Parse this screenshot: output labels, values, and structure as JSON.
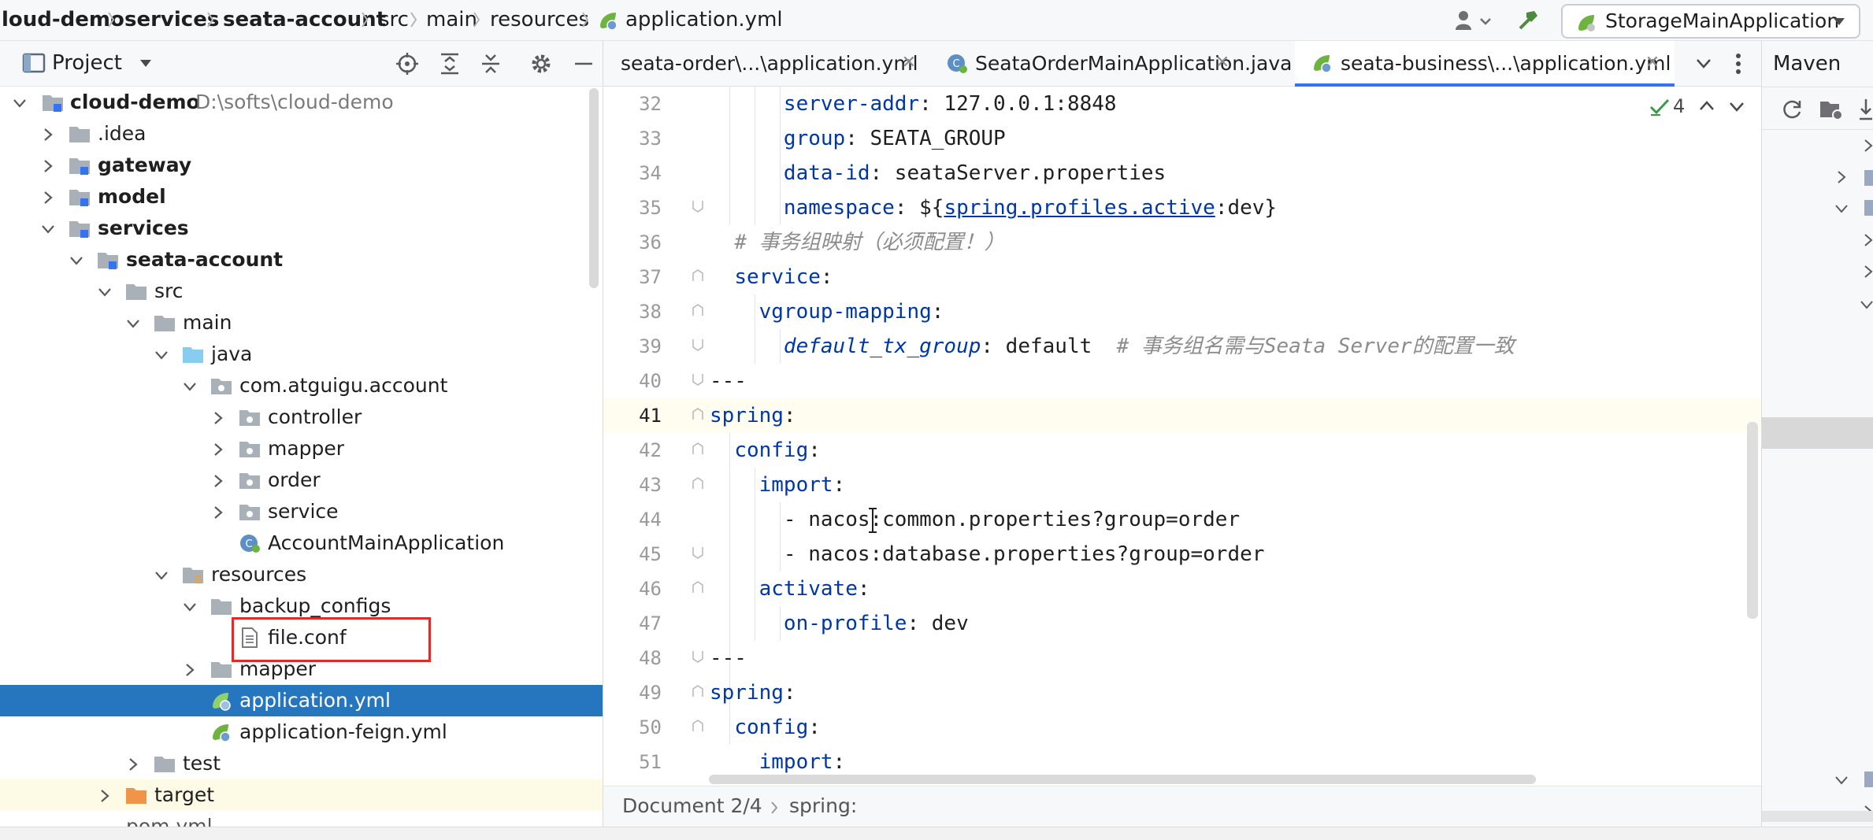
{
  "breadcrumb": {
    "items": [
      "loud-demo",
      "services",
      "seata-account",
      "src",
      "main",
      "resources",
      "application.yml"
    ]
  },
  "toolbar": {
    "run_config": "StorageMainApplication"
  },
  "project_panel": {
    "title": "Project",
    "tree": [
      {
        "label": "cloud-demo",
        "path": "D:\\softs\\cloud-demo"
      },
      {
        "label": ".idea"
      },
      {
        "label": "gateway"
      },
      {
        "label": "model"
      },
      {
        "label": "services"
      },
      {
        "label": "seata-account"
      },
      {
        "label": "src"
      },
      {
        "label": "main"
      },
      {
        "label": "java"
      },
      {
        "label": "com.atguigu.account"
      },
      {
        "label": "controller"
      },
      {
        "label": "mapper"
      },
      {
        "label": "order"
      },
      {
        "label": "service"
      },
      {
        "label": "AccountMainApplication"
      },
      {
        "label": "resources"
      },
      {
        "label": "backup_configs"
      },
      {
        "label": "file.conf"
      },
      {
        "label": "mapper"
      },
      {
        "label": "application.yml"
      },
      {
        "label": "application-feign.yml"
      },
      {
        "label": "test"
      },
      {
        "label": "target"
      },
      {
        "label": "pom.yml"
      }
    ]
  },
  "editor": {
    "tabs": [
      {
        "label": "seata-order\\...\\application.yml"
      },
      {
        "label": "SeataOrderMainApplication.java"
      },
      {
        "label": "seata-business\\...\\application.yml"
      }
    ],
    "inspection_count": "4",
    "lines": [
      {
        "num": "32",
        "indent": "      ",
        "key": "server-addr",
        "value": ": 127.0.0.1:8848"
      },
      {
        "num": "33",
        "indent": "      ",
        "key": "group",
        "value": ": SEATA_GROUP"
      },
      {
        "num": "34",
        "indent": "      ",
        "key": "data-id",
        "value": ": seataServer.properties"
      },
      {
        "num": "35",
        "indent": "      ",
        "key": "namespace",
        "value": ": ${",
        "link": "spring.profiles.active",
        "tail": ":dev}"
      },
      {
        "num": "36",
        "indent": "  ",
        "comment": "# 事务组映射（必须配置！）"
      },
      {
        "num": "37",
        "indent": "  ",
        "key": "service",
        "value": ":"
      },
      {
        "num": "38",
        "indent": "    ",
        "key": "vgroup-mapping",
        "value": ":"
      },
      {
        "num": "39",
        "indent": "      ",
        "ikey": "default_tx_group",
        "value": ": default  ",
        "comment": "# 事务组名需与Seata Server的配置一致"
      },
      {
        "num": "40",
        "indent": "",
        "value": "---"
      },
      {
        "num": "41",
        "indent": "",
        "key": "spring",
        "value": ":"
      },
      {
        "num": "42",
        "indent": "  ",
        "key": "config",
        "value": ":"
      },
      {
        "num": "43",
        "indent": "    ",
        "key": "import",
        "value": ":"
      },
      {
        "num": "44",
        "indent": "      ",
        "value": "- nacos:common.properties?group=order"
      },
      {
        "num": "45",
        "indent": "      ",
        "value": "- nacos:database.properties?group=order"
      },
      {
        "num": "46",
        "indent": "    ",
        "key": "activate",
        "value": ":"
      },
      {
        "num": "47",
        "indent": "      ",
        "key": "on-profile",
        "value": ": dev"
      },
      {
        "num": "48",
        "indent": "",
        "value": "---"
      },
      {
        "num": "49",
        "indent": "",
        "key": "spring",
        "value": ":"
      },
      {
        "num": "50",
        "indent": "  ",
        "key": "config",
        "value": ":"
      },
      {
        "num": "51",
        "indent": "    ",
        "key": "import",
        "value": ":"
      }
    ],
    "status_breadcrumb": {
      "doc": "Document 2/4",
      "node": "spring:"
    }
  },
  "maven_panel": {
    "title": "Maven"
  },
  "colors": {
    "accent": "#3574f0",
    "selection": "#2675bf",
    "key": "#0037a6",
    "highlight_box": "#e02b2b"
  }
}
